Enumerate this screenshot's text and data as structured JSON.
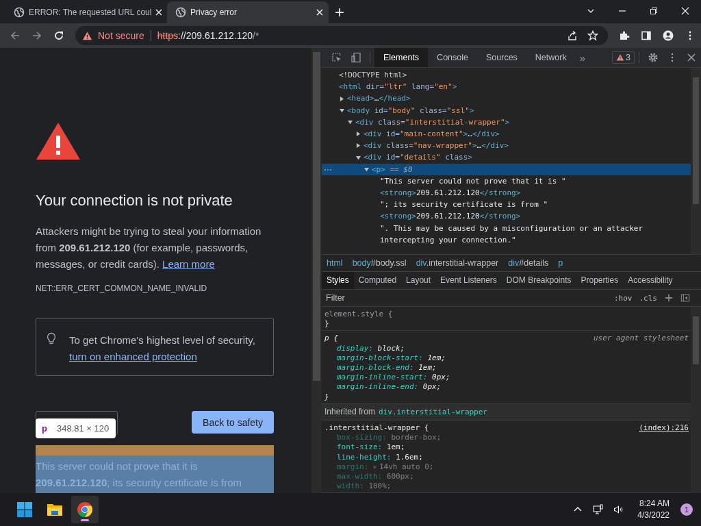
{
  "browser_tabs": [
    {
      "title": "ERROR: The requested URL coul",
      "selected": false
    },
    {
      "title": "Privacy error",
      "selected": true
    }
  ],
  "new_tab": "+",
  "address_bar": {
    "security": "Not secure",
    "scheme": "https",
    "host": "://209.61.212.120",
    "path": "/*"
  },
  "page": {
    "heading": "Your connection is not private",
    "body": "Attackers might be trying to steal your information from **209.61.212.120** (for example, passwords, messages, or credit cards).",
    "learn_more": "Learn more",
    "error_code": "NET::ERR_CERT_COMMON_NAME_INVALID",
    "protection_text": "To get Chrome's highest level of security,",
    "protection_link": "turn on enhanced protection",
    "back_button": "Back to safety",
    "tooltip": {
      "tag": "p",
      "size": "348.81 × 120"
    },
    "details_lines": [
      "This server could not prove that it is",
      "**209.61.212.120**; its security certificate is from"
    ]
  },
  "devtools": {
    "tabs": [
      {
        "label": "Elements",
        "selected": true
      },
      {
        "label": "Console",
        "selected": false
      },
      {
        "label": "Sources",
        "selected": false
      },
      {
        "label": "Network",
        "selected": false
      }
    ],
    "more_tabs": "»",
    "issues": "3",
    "dom": [
      {
        "tokens": [
          {
            "kind": "doctype",
            "text": "<!DOCTYPE html>"
          }
        ],
        "selected": false
      },
      {
        "tokens": [
          {
            "kind": "tag",
            "text": "<html"
          },
          {
            "kind": "attr",
            "text": " dir="
          },
          {
            "kind": "value",
            "text": "\"ltr\""
          },
          {
            "kind": "attr",
            "text": " lang="
          },
          {
            "kind": "value",
            "text": "\"en\""
          },
          {
            "kind": "tag",
            "text": ">"
          }
        ],
        "selected": false,
        "children": [
          {
            "tokens": [
              {
                "kind": "tag",
                "text": "<head>"
              },
              {
                "kind": "text",
                "text": "…"
              },
              {
                "kind": "tag",
                "text": "</head>"
              }
            ],
            "expanded": false,
            "selected": false
          },
          {
            "tokens": [
              {
                "kind": "tag",
                "text": "<body"
              },
              {
                "kind": "attr",
                "text": " id="
              },
              {
                "kind": "value",
                "text": "\"body\""
              },
              {
                "kind": "attr",
                "text": " class="
              },
              {
                "kind": "value",
                "text": "\"ssl\""
              },
              {
                "kind": "tag",
                "text": ">"
              }
            ],
            "expanded": true,
            "selected": false,
            "children": [
              {
                "tokens": [
                  {
                    "kind": "tag",
                    "text": "<div"
                  },
                  {
                    "kind": "attr",
                    "text": " class="
                  },
                  {
                    "kind": "value",
                    "text": "\"interstitial-wrapper\""
                  },
                  {
                    "kind": "tag",
                    "text": ">"
                  }
                ],
                "expanded": true,
                "selected": false,
                "children": [
                  {
                    "tokens": [
                      {
                        "kind": "tag",
                        "text": "<div"
                      },
                      {
                        "kind": "attr",
                        "text": " id="
                      },
                      {
                        "kind": "value",
                        "text": "\"main-content\""
                      },
                      {
                        "kind": "tag",
                        "text": ">"
                      },
                      {
                        "kind": "text",
                        "text": "…"
                      },
                      {
                        "kind": "tag",
                        "text": "</div>"
                      }
                    ],
                    "expanded": false,
                    "selected": false
                  },
                  {
                    "tokens": [
                      {
                        "kind": "tag",
                        "text": "<div"
                      },
                      {
                        "kind": "attr",
                        "text": " class="
                      },
                      {
                        "kind": "value",
                        "text": "\"nav-wrapper\""
                      },
                      {
                        "kind": "tag",
                        "text": ">"
                      },
                      {
                        "kind": "text",
                        "text": "…"
                      },
                      {
                        "kind": "tag",
                        "text": "</div>"
                      }
                    ],
                    "expanded": false,
                    "selected": false
                  },
                  {
                    "tokens": [
                      {
                        "kind": "tag",
                        "text": "<div"
                      },
                      {
                        "kind": "attr",
                        "text": " id="
                      },
                      {
                        "kind": "value",
                        "text": "\"details\""
                      },
                      {
                        "kind": "attr",
                        "text": " class"
                      },
                      {
                        "kind": "tag",
                        "text": ">"
                      }
                    ],
                    "expanded": true,
                    "selected": false,
                    "children": [
                      {
                        "tokens": [
                          {
                            "kind": "tag",
                            "text": "<p>"
                          },
                          {
                            "kind": "marker",
                            "text": " == $0"
                          }
                        ],
                        "expanded": true,
                        "selected": true,
                        "children": [
                          {
                            "tokens": [
                              {
                                "kind": "text",
                                "text": "\"This server could not prove that it is \""
                              }
                            ],
                            "selected": false
                          },
                          {
                            "tokens": [
                              {
                                "kind": "tag",
                                "text": "<strong>"
                              },
                              {
                                "kind": "text",
                                "text": "209.61.212.120"
                              },
                              {
                                "kind": "tag",
                                "text": "</strong>"
                              }
                            ],
                            "selected": false
                          },
                          {
                            "tokens": [
                              {
                                "kind": "text",
                                "text": "\"; its security certificate is from \""
                              }
                            ],
                            "selected": false
                          },
                          {
                            "tokens": [
                              {
                                "kind": "tag",
                                "text": "<strong>"
                              },
                              {
                                "kind": "text",
                                "text": "209.61.212.120"
                              },
                              {
                                "kind": "tag",
                                "text": "</strong>"
                              }
                            ],
                            "selected": false
                          },
                          {
                            "tokens": [
                              {
                                "kind": "text",
                                "text": "\". This may be caused by a misconfiguration or an attacker intercepting your connection.\""
                              }
                            ],
                            "selected": false
                          }
                        ]
                      }
                    ]
                  }
                ]
              }
            ]
          }
        ]
      }
    ],
    "breadcrumbs": [
      {
        "tag": "html"
      },
      {
        "tag": "body",
        "rest": "#body.ssl"
      },
      {
        "tag": "div",
        "rest": ".interstitial-wrapper"
      },
      {
        "tag": "div",
        "rest": "#details"
      },
      {
        "tag": "p"
      }
    ],
    "style_tabs": [
      {
        "label": "Styles",
        "selected": true
      },
      {
        "label": "Computed",
        "selected": false
      },
      {
        "label": "Layout",
        "selected": false
      },
      {
        "label": "Event Listeners",
        "selected": false
      },
      {
        "label": "DOM Breakpoints",
        "selected": false
      },
      {
        "label": "Properties",
        "selected": false
      },
      {
        "label": "Accessibility",
        "selected": false
      }
    ],
    "filter_placeholder": "Filter",
    "hov": ":hov",
    "cls": ".cls",
    "sections": [
      {
        "kind": "rule",
        "muted_selector": true,
        "italic": false,
        "selector": "element.style {",
        "close": "}"
      },
      {
        "kind": "rule",
        "muted_selector": false,
        "italic": true,
        "source_link": false,
        "selector": "p {",
        "source": "user agent stylesheet",
        "close": "}",
        "decls": [
          {
            "name": "display:",
            "value": "block;",
            "dimmed": false
          },
          {
            "name": "margin-block-start:",
            "value": "1em;",
            "dimmed": false
          },
          {
            "name": "margin-block-end:",
            "value": "1em;",
            "dimmed": false
          },
          {
            "name": "margin-inline-start:",
            "value": "0px;",
            "dimmed": false
          },
          {
            "name": "margin-inline-end:",
            "value": "0px;",
            "dimmed": false
          }
        ]
      },
      {
        "kind": "inherited",
        "label": "Inherited from",
        "from": "div.interstitial-wrapper"
      },
      {
        "kind": "rule",
        "muted_selector": false,
        "italic": false,
        "source_link": true,
        "selector": ".interstitial-wrapper {",
        "source": "(index):216",
        "decls": [
          {
            "name": "box-sizing:",
            "value": "border-box;",
            "dimmed": true
          },
          {
            "name": "font-size:",
            "value": "1em;",
            "dimmed": false
          },
          {
            "name": "line-height:",
            "value": "1.6em;",
            "dimmed": false
          },
          {
            "name": "margin:",
            "value": "14vh auto 0;",
            "dimmed": true,
            "expandable": true
          },
          {
            "name": "max-width:",
            "value": "600px;",
            "dimmed": true
          },
          {
            "name": "width:",
            "value": "100%;",
            "dimmed": true
          }
        ]
      }
    ]
  },
  "taskbar": {
    "apps": [
      {
        "kind": "start",
        "selected": false
      },
      {
        "kind": "explorer",
        "selected": false
      },
      {
        "kind": "chrome",
        "selected": true
      }
    ],
    "time": "8:24 AM",
    "date": "4/3/2022",
    "notifications": "1"
  }
}
